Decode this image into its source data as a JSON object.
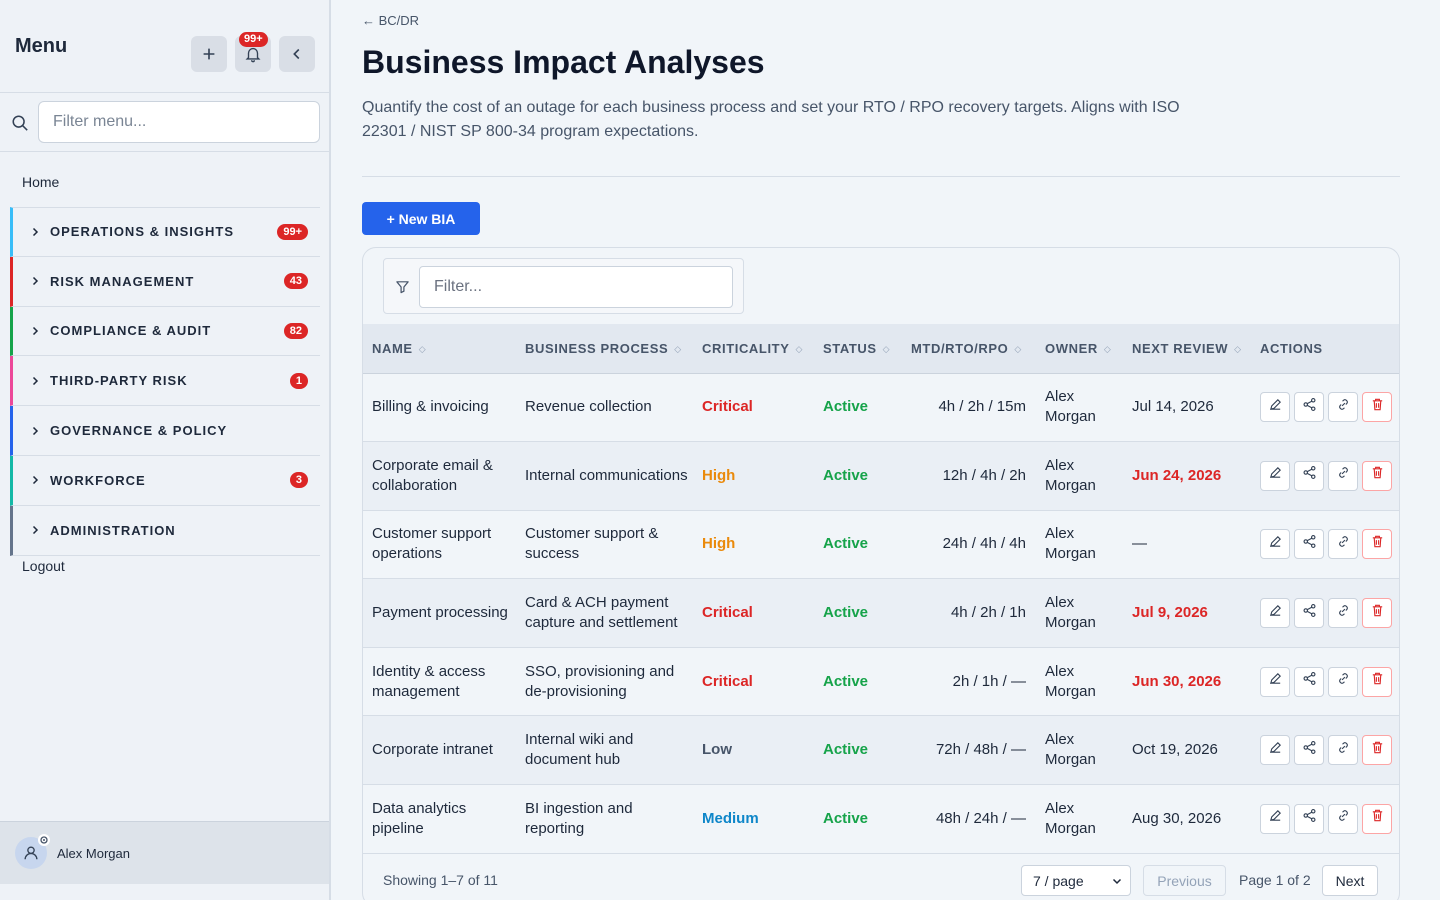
{
  "sidebar": {
    "title": "Menu",
    "bell_badge": "99+",
    "filter_placeholder": "Filter menu...",
    "home": "Home",
    "items": [
      {
        "label": "OPERATIONS & INSIGHTS",
        "count": "99+",
        "color": "#38bdf8"
      },
      {
        "label": "RISK MANAGEMENT",
        "count": "43",
        "color": "#dc2626"
      },
      {
        "label": "COMPLIANCE & AUDIT",
        "count": "82",
        "color": "#16a34a"
      },
      {
        "label": "THIRD-PARTY RISK",
        "count": "1",
        "color": "#ec4899"
      },
      {
        "label": "GOVERNANCE & POLICY",
        "count": "",
        "color": "#2563eb"
      },
      {
        "label": "WORKFORCE",
        "count": "3",
        "color": "#14b8a6"
      },
      {
        "label": "ADMINISTRATION",
        "count": "",
        "color": "#64748b"
      }
    ],
    "logout": "Logout",
    "user_name": "Alex Morgan"
  },
  "main": {
    "back_link": "← BC/DR",
    "title": "Business Impact Analyses",
    "description": "Quantify the cost of an outage for each business process and set your RTO / RPO recovery targets. Aligns with ISO 22301 / NIST SP 800-34 program expectations.",
    "new_button": "+ New BIA",
    "filter_placeholder": "Filter...",
    "columns": [
      "NAME",
      "BUSINESS PROCESS",
      "CRITICALITY",
      "STATUS",
      "MTD/RTO/RPO",
      "OWNER",
      "NEXT REVIEW",
      "ACTIONS"
    ],
    "rows": [
      {
        "name": "Billing & invoicing",
        "process": "Revenue collection",
        "criticality": "Critical",
        "status": "Active",
        "targets": "4h / 2h / 15m",
        "owner": "Alex Morgan",
        "review": "Jul 14, 2026",
        "overdue": false
      },
      {
        "name": "Corporate email & collaboration",
        "process": "Internal communications",
        "criticality": "High",
        "status": "Active",
        "targets": "12h / 4h / 2h",
        "owner": "Alex Morgan",
        "review": "Jun 24, 2026",
        "overdue": true
      },
      {
        "name": "Customer support operations",
        "process": "Customer support & success",
        "criticality": "High",
        "status": "Active",
        "targets": "24h / 4h / 4h",
        "owner": "Alex Morgan",
        "review": "—",
        "overdue": false
      },
      {
        "name": "Payment processing",
        "process": "Card & ACH payment capture and settlement",
        "criticality": "Critical",
        "status": "Active",
        "targets": "4h / 2h / 1h",
        "owner": "Alex Morgan",
        "review": "Jul 9, 2026",
        "overdue": true
      },
      {
        "name": "Identity & access management",
        "process": "SSO, provisioning and de-provisioning",
        "criticality": "Critical",
        "status": "Active",
        "targets": "2h / 1h / —",
        "owner": "Alex Morgan",
        "review": "Jun 30, 2026",
        "overdue": true
      },
      {
        "name": "Corporate intranet",
        "process": "Internal wiki and document hub",
        "criticality": "Low",
        "status": "Active",
        "targets": "72h / 48h / —",
        "owner": "Alex Morgan",
        "review": "Oct 19, 2026",
        "overdue": false
      },
      {
        "name": "Data analytics pipeline",
        "process": "BI ingestion and reporting",
        "criticality": "Medium",
        "status": "Active",
        "targets": "48h / 24h / —",
        "owner": "Alex Morgan",
        "review": "Aug 30, 2026",
        "overdue": false
      }
    ],
    "criticality_colors": {
      "Critical": "#dc2626",
      "High": "#ea8a0c",
      "Medium": "#0e86c9",
      "Low": "#475569"
    },
    "footer": {
      "showing": "Showing 1–7 of 11",
      "page_size": "7 / page",
      "previous": "Previous",
      "page_of": "Page 1 of 2",
      "next": "Next"
    }
  }
}
